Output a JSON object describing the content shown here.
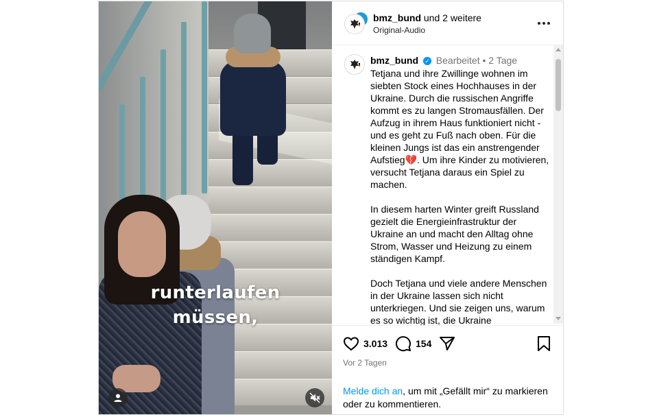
{
  "video": {
    "caption_line1": "runterlaufen",
    "caption_line2": "müssen,",
    "user_icon": "user-icon",
    "mute_icon": "audio-muted-icon"
  },
  "header": {
    "username": "bmz_bund",
    "collab_suffix": "und 2 weitere",
    "audio": "Original-Audio",
    "more_icon": "more-options-icon",
    "story_ring_color": "#1d9bd7"
  },
  "post": {
    "username": "bmz_bund",
    "edited": "Bearbeitet",
    "separator": "•",
    "age": "2 Tage",
    "paragraph1": "Tetjana und ihre Zwillinge wohnen im siebten Stock eines Hochhauses in der Ukraine. Durch die russischen Angriffe kommt es zu langen Stromausfällen. Der Aufzug in ihrem Haus funktioniert nicht - und es geht zu Fuß nach oben. Für die kleinen Jungs ist das ein anstrengender Aufstieg💔. Um ihre Kinder zu motivieren, versucht Tetjana daraus ein Spiel zu machen.",
    "paragraph2": "In diesem harten Winter greift Russland gezielt die Energieinfrastruktur der Ukraine an und macht den Alltag ohne Strom, Wasser und Heizung zu einem ständigen Kampf.",
    "paragraph3": "Doch Tetjana und viele andere Menschen in der Ukraine lassen sich nicht unterkriegen. Und sie zeigen uns, warum es so wichtig ist, die Ukraine"
  },
  "actions": {
    "likes": "3.013",
    "comments": "154",
    "posted": "Vor 2 Tagen"
  },
  "login_prompt": {
    "link": "Melde dich an",
    "rest": ", um mit „Gefällt mir“ zu markieren oder zu kommentieren."
  },
  "colors": {
    "link_blue": "#0095f6",
    "verified_blue": "#0095f6",
    "muted_text": "#737373"
  }
}
